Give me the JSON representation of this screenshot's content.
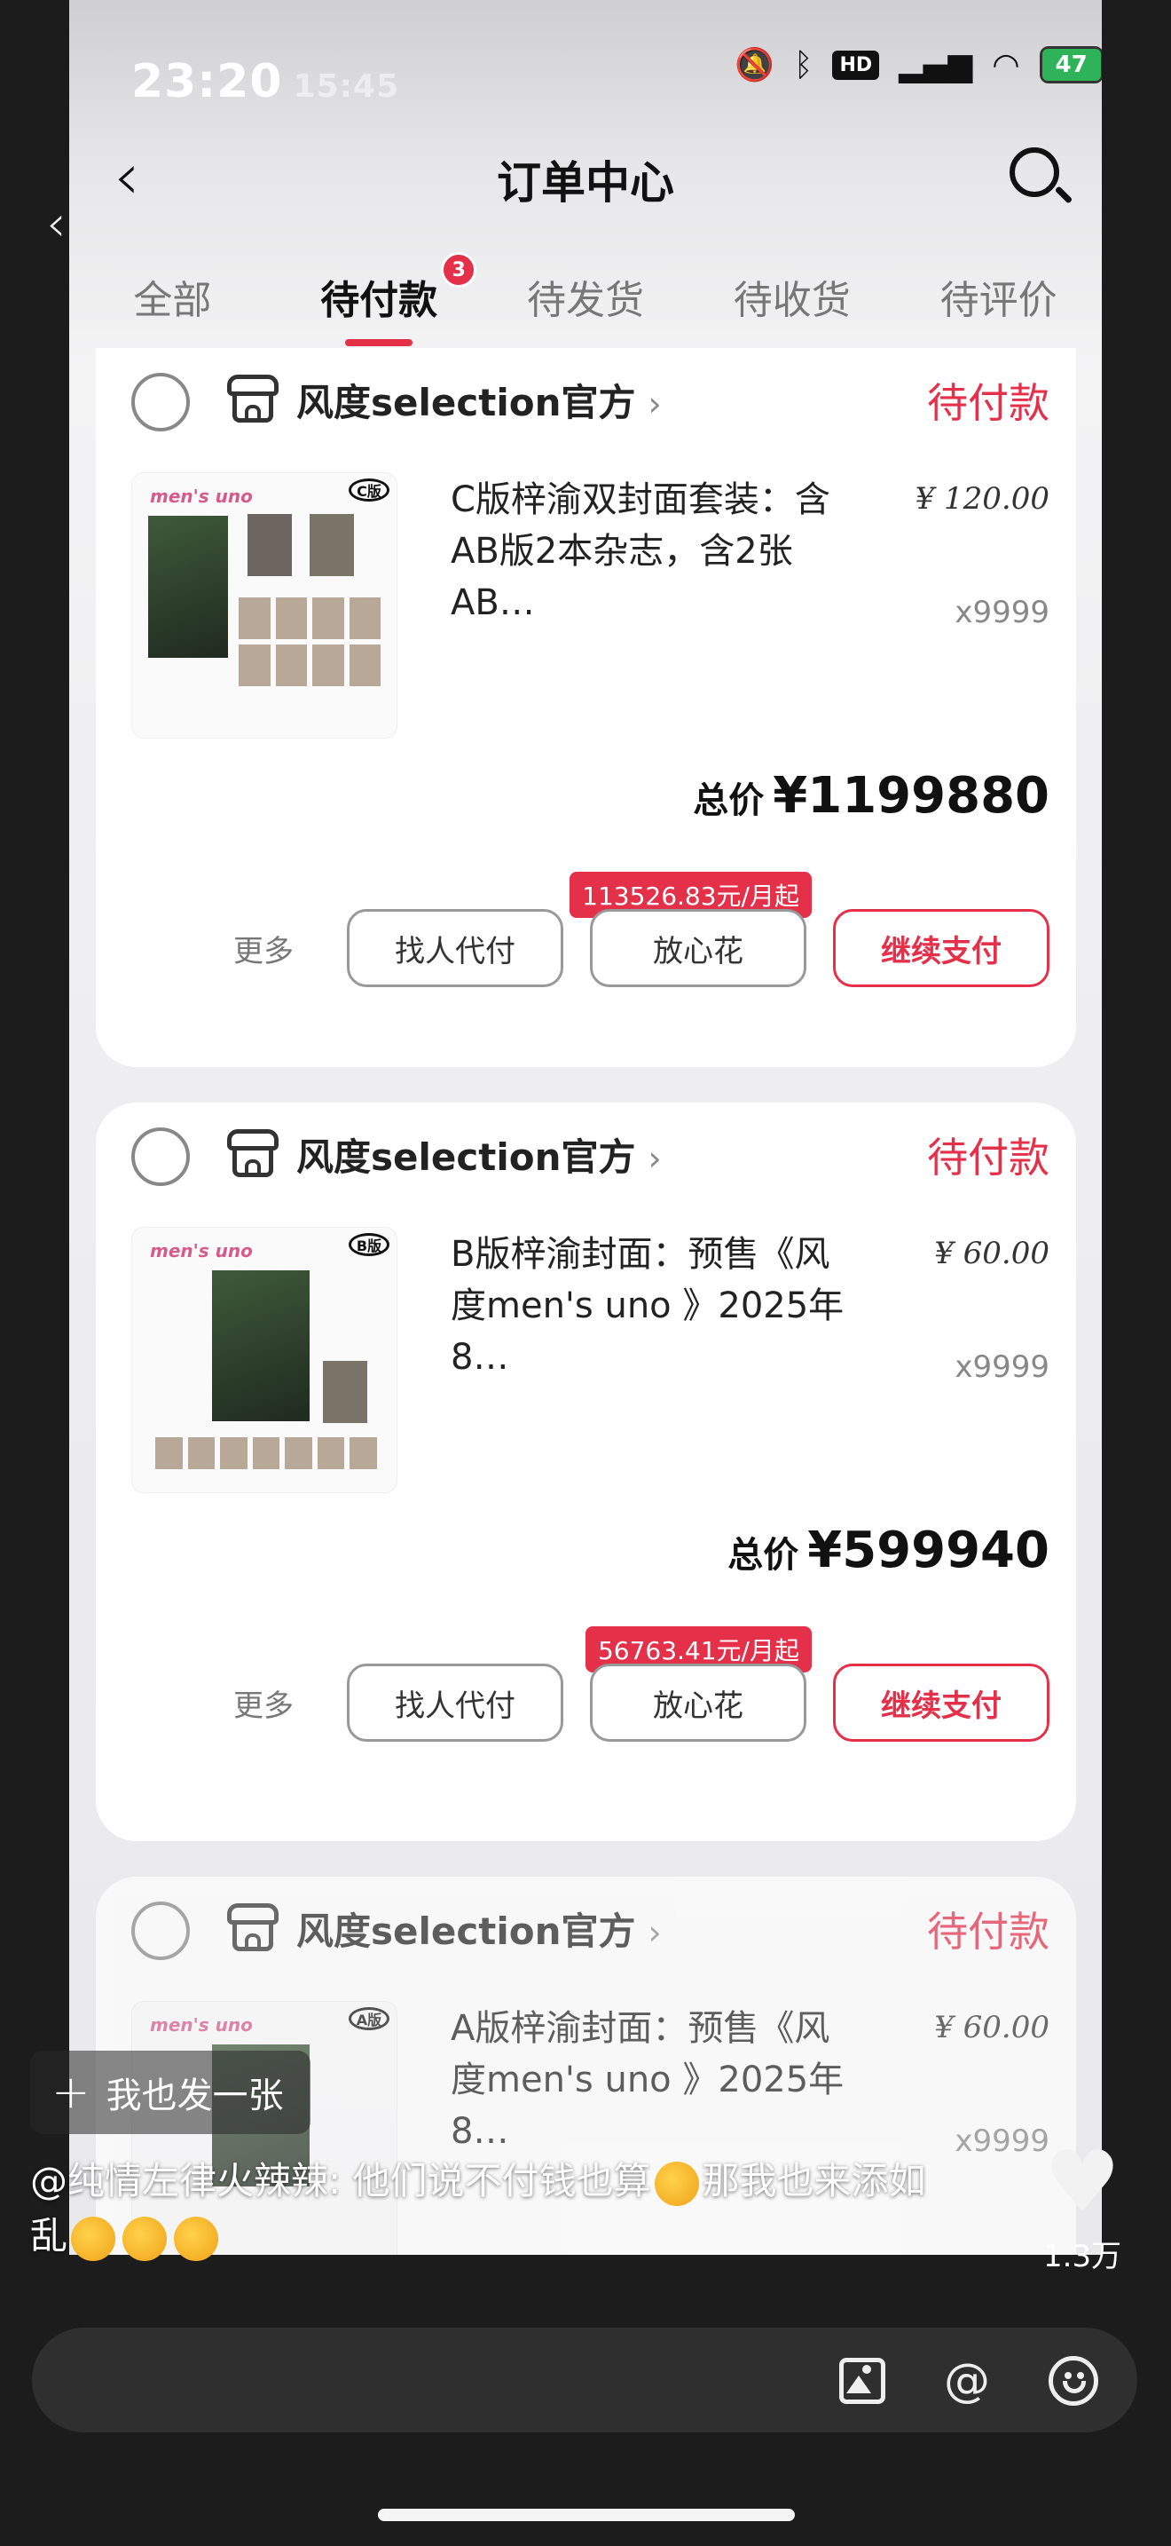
{
  "status_bar": {
    "time": "23:20",
    "ghost_time": "15:45",
    "battery": "47"
  },
  "header": {
    "title": "订单中心"
  },
  "tabs": [
    {
      "label": "全部"
    },
    {
      "label": "待付款",
      "badge": "3"
    },
    {
      "label": "待发货"
    },
    {
      "label": "待收货"
    },
    {
      "label": "待评价"
    }
  ],
  "orders": [
    {
      "store": "风度selection官方",
      "status": "待付款",
      "version_tag": "C版",
      "title_line1": "C版梓渝双封面套装：含",
      "title_line2": "AB版2本杂志，含2张AB…",
      "price": "¥ 120.00",
      "qty": "x9999",
      "total_label": "总价",
      "total": "¥1199880",
      "installment": "113526.83元/月起",
      "more": "更多",
      "btn_proxy": "找人代付",
      "btn_flex": "放心花",
      "btn_pay": "继续支付"
    },
    {
      "store": "风度selection官方",
      "status": "待付款",
      "version_tag": "B版",
      "title_line1": "B版梓渝封面：预售《风",
      "title_line2": "度men's uno 》2025年8…",
      "price": "¥ 60.00",
      "qty": "x9999",
      "total_label": "总价",
      "total": "¥599940",
      "installment": "56763.41元/月起",
      "more": "更多",
      "btn_proxy": "找人代付",
      "btn_flex": "放心花",
      "btn_pay": "继续支付"
    },
    {
      "store": "风度selection官方",
      "status": "待付款",
      "version_tag": "A版",
      "title_line1": "A版梓渝封面：预售《风",
      "title_line2": "度men's uno 》2025年8…",
      "price": "¥ 60.00",
      "qty": "x9999"
    }
  ],
  "overlay": {
    "post_button": "我也发一张",
    "caption_prefix": "@纯情左律火辣辣: 他们说不付钱也算",
    "caption_mid": "那我也来添如",
    "caption_line2": "乱",
    "like_count": "1.3万"
  },
  "colors": {
    "accent": "#e5304a",
    "battery": "#2fb35a"
  },
  "icons": [
    "back-icon",
    "search-icon",
    "store-icon",
    "chevron-right-icon",
    "image-icon",
    "at-icon",
    "emoji-icon",
    "heart-icon",
    "plus-icon"
  ]
}
